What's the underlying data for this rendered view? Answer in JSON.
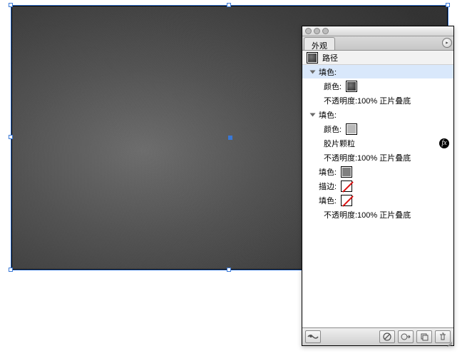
{
  "panel": {
    "tab_label": "外观",
    "object_row": {
      "label": "路径"
    },
    "rows": [
      {
        "kind": "header",
        "label": "填色:"
      },
      {
        "kind": "color",
        "label": "颜色:",
        "swatch": "grad"
      },
      {
        "kind": "opacity",
        "text": "不透明度:100% 正片叠底"
      },
      {
        "kind": "header",
        "label": "填色:"
      },
      {
        "kind": "color",
        "label": "颜色:",
        "swatch": "grey"
      },
      {
        "kind": "effect",
        "label": "胶片颗粒"
      },
      {
        "kind": "opacity",
        "text": "不透明度:100% 正片叠底"
      },
      {
        "kind": "attr",
        "label": "填色:",
        "swatch": "mid"
      },
      {
        "kind": "attr",
        "label": "描边:",
        "swatch": "none"
      },
      {
        "kind": "attr",
        "label": "填色:",
        "swatch": "none"
      },
      {
        "kind": "opacity",
        "text": "不透明度:100% 正片叠底"
      }
    ]
  }
}
